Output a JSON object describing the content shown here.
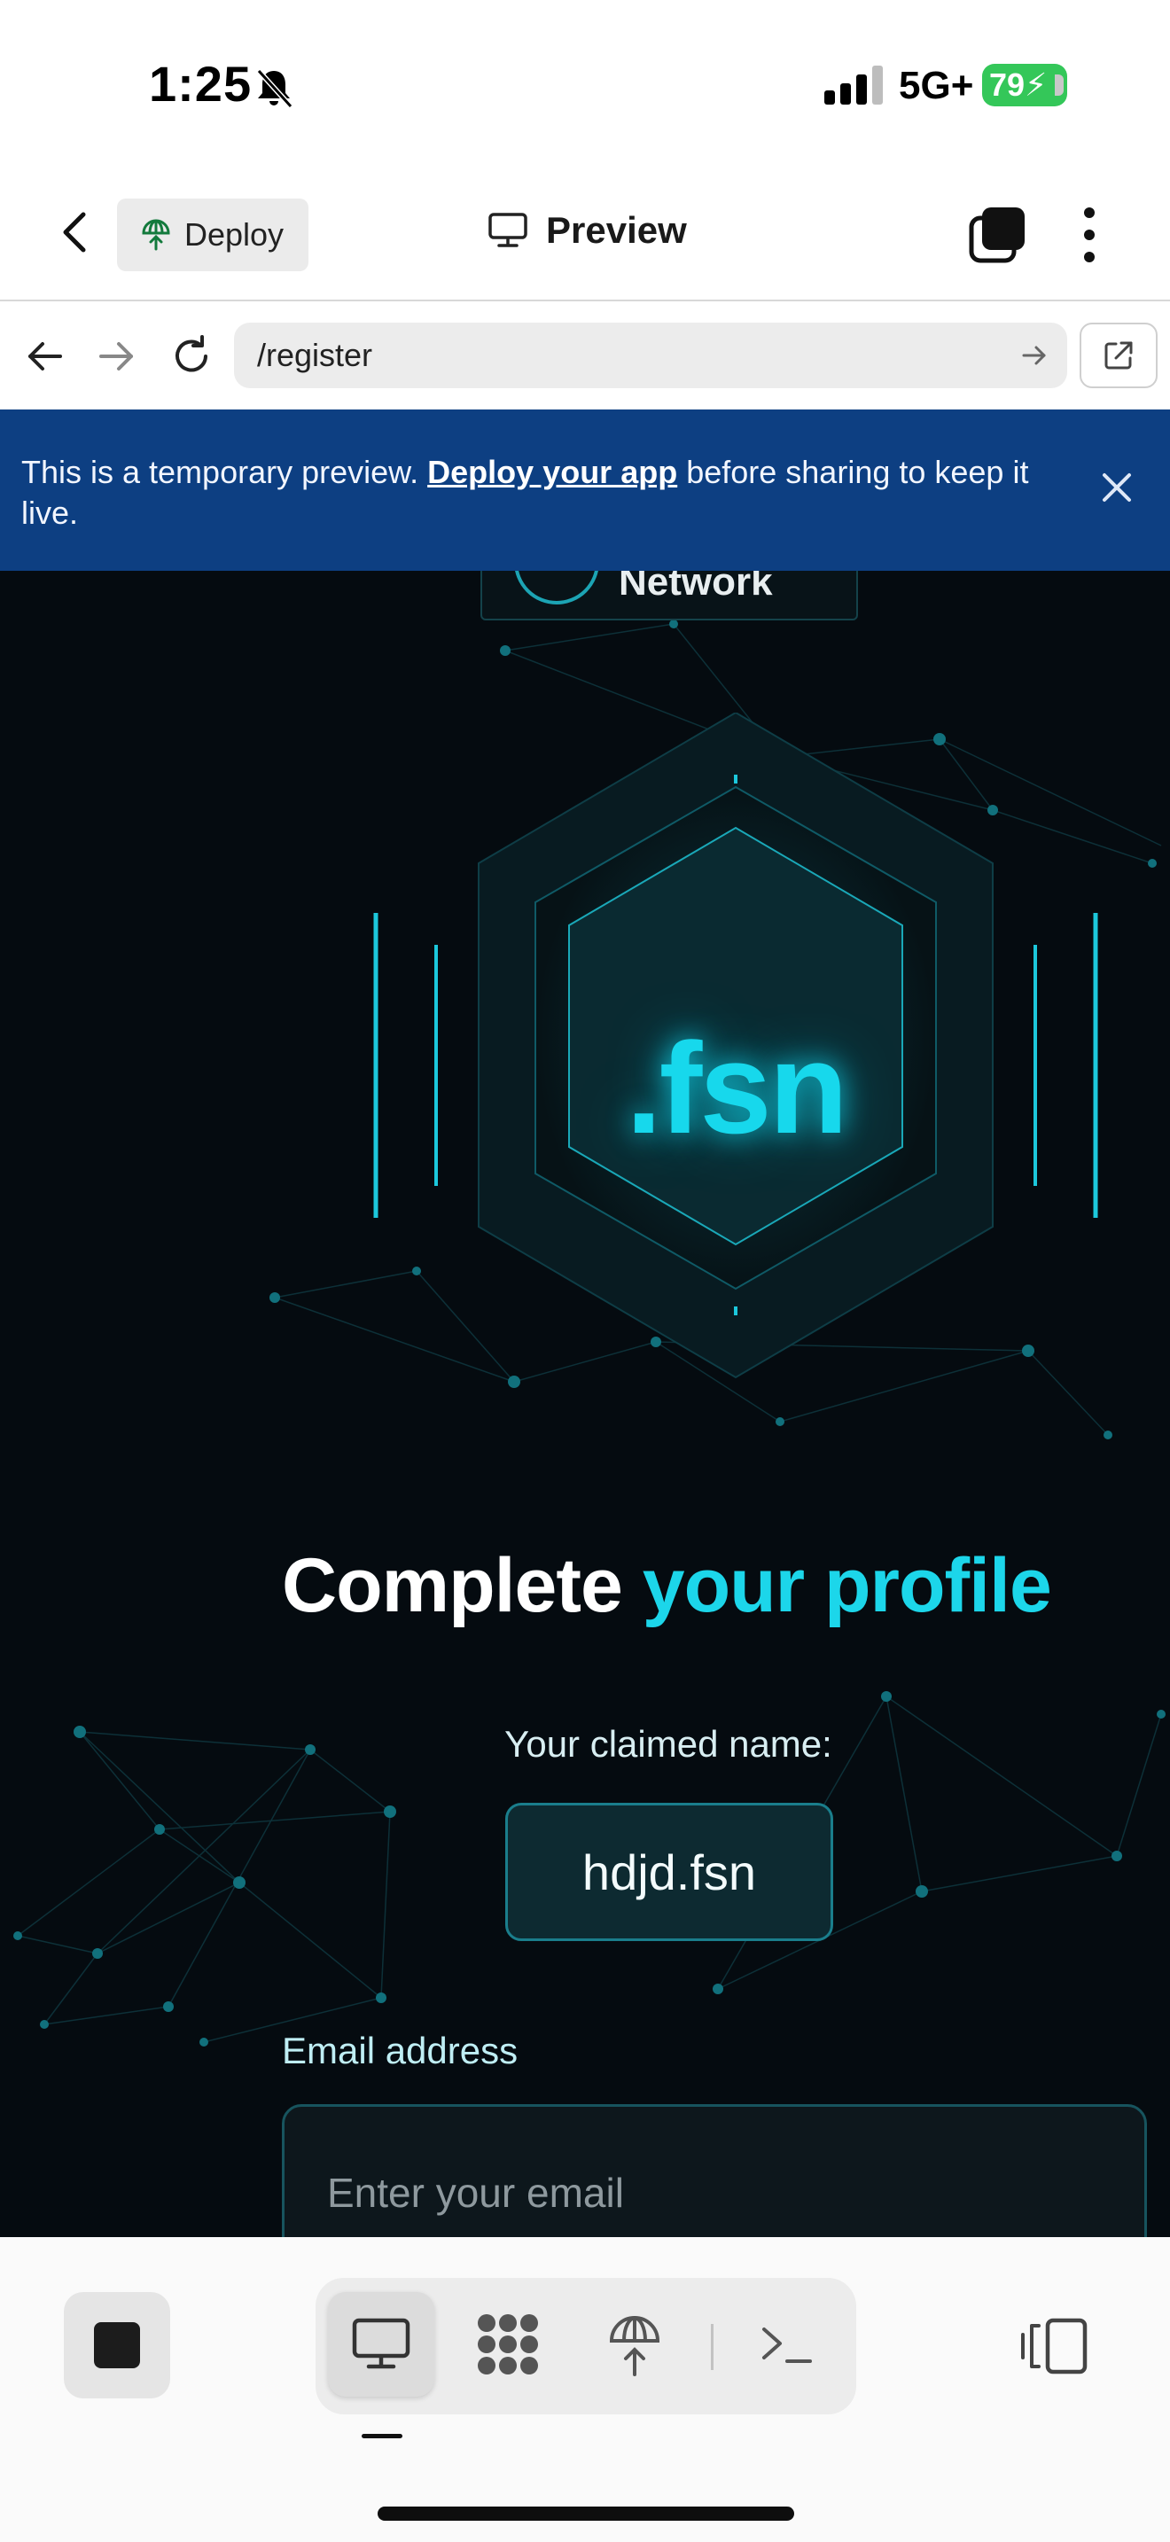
{
  "status_bar": {
    "time": "1:25",
    "network": "5G+",
    "battery": "79"
  },
  "header": {
    "deploy_label": "Deploy",
    "title": "Preview"
  },
  "url_bar": {
    "path": "/register"
  },
  "banner": {
    "text_before": "This is a temporary preview. ",
    "link_text": "Deploy your app",
    "text_after": " before sharing to keep it live."
  },
  "page": {
    "logo_text": "Network",
    "domain_badge": ".fsn",
    "headline_white": "Complete ",
    "headline_accent": "your profile",
    "claimed_label": "Your claimed name:",
    "claimed_name": "hdjd.fsn",
    "email_label": "Email address",
    "email_placeholder": "Enter your email",
    "email_value": ""
  },
  "colors": {
    "accent": "#1cd6ea",
    "banner": "#0d3f82",
    "page_bg": "#050b10",
    "battery": "#34c759"
  },
  "toolbar": {
    "icons": [
      "stop-icon",
      "desktop-preview-icon",
      "nodes-icon",
      "deploy-icon",
      "terminal-icon",
      "split-view-icon"
    ]
  }
}
